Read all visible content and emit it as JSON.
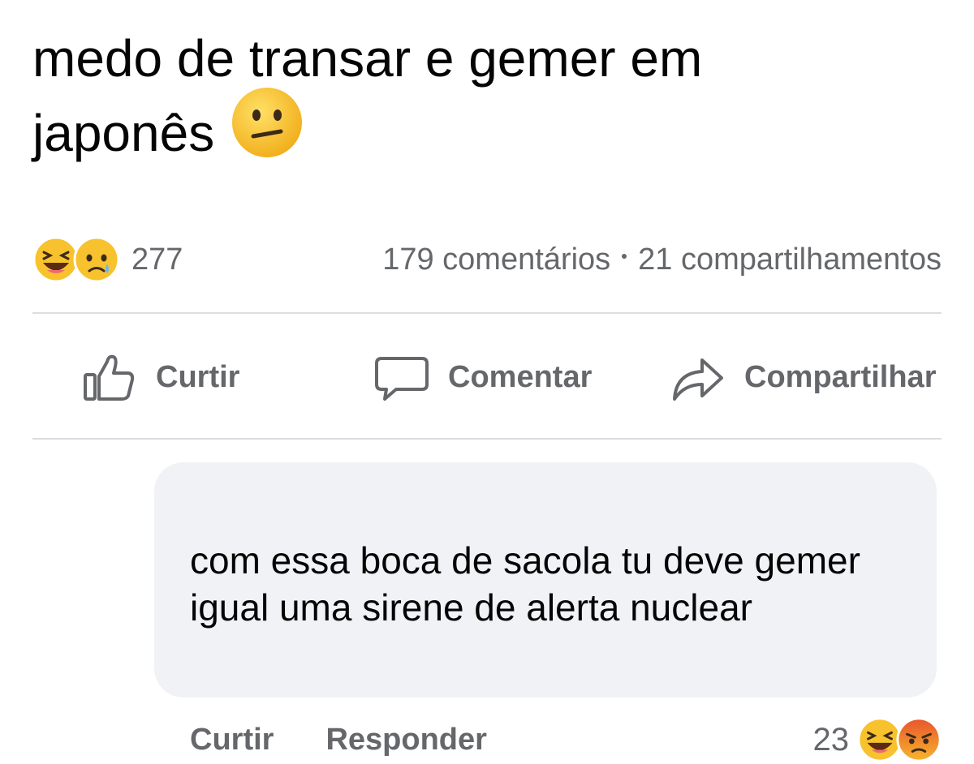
{
  "post": {
    "text": "medo de transar e gemer em japonês",
    "text_line1": "medo de transar e gemer em",
    "text_line2": "japonês",
    "emoji": "confused-face"
  },
  "stats": {
    "reaction_count": "277",
    "reactions": [
      "laughing-face",
      "crying-face"
    ],
    "comments": "179 comentários",
    "separator": "•",
    "shares": "21 compartilhamentos"
  },
  "actions": {
    "like": "Curtir",
    "comment": "Comentar",
    "share": "Compartilhar"
  },
  "comment": {
    "text": "com essa boca de sacola tu deve gemer igual uma sirene de alerta nuclear",
    "like_label": "Curtir",
    "reply_label": "Responder",
    "reaction_count": "23",
    "reactions": [
      "laughing-face",
      "angry-face"
    ]
  },
  "colors": {
    "text": "#050505",
    "secondary_text": "#65676b",
    "divider": "#dadde1",
    "bubble": "#f0f2f5",
    "emoji_yellow": "#f7c22e"
  }
}
